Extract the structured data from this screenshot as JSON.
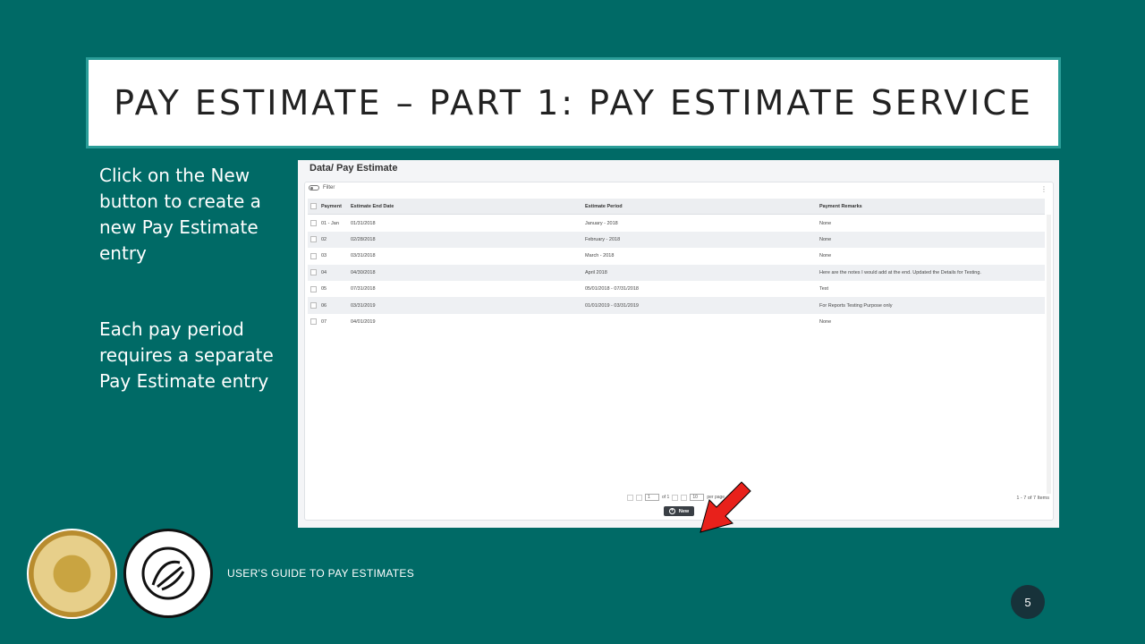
{
  "slide": {
    "title": "PAY ESTIMATE – PART 1: PAY ESTIMATE SERVICE",
    "bullet1": "Click on the New button to create a new Pay Estimate entry",
    "bullet2": "Each pay period requires a separate Pay Estimate entry",
    "footer": "USER'S GUIDE TO PAY ESTIMATES",
    "page_number": "5"
  },
  "app": {
    "breadcrumb": "Data/ Pay Estimate",
    "filter_label": "Filter",
    "columns": [
      "Payment",
      "Estimate End Date",
      "Estimate Period",
      "Payment Remarks"
    ],
    "rows": [
      {
        "payment": "01 - Jan",
        "end_date": "01/31/2018",
        "period": "January - 2018",
        "remarks": "None"
      },
      {
        "payment": "02",
        "end_date": "02/28/2018",
        "period": "February - 2018",
        "remarks": "None"
      },
      {
        "payment": "03",
        "end_date": "03/31/2018",
        "period": "March - 2018",
        "remarks": "None"
      },
      {
        "payment": "04",
        "end_date": "04/30/2018",
        "period": "April 2018",
        "remarks": "Here are the notes I would add at the end. Updated the Details for Testing."
      },
      {
        "payment": "05",
        "end_date": "07/31/2018",
        "period": "05/01/2018 - 07/31/2018",
        "remarks": "Test"
      },
      {
        "payment": "06",
        "end_date": "03/31/2019",
        "period": "01/01/2019 - 03/31/2019",
        "remarks": "For Reports Testing Purpose only"
      },
      {
        "payment": "07",
        "end_date": "04/01/2019",
        "period": "",
        "remarks": "None"
      }
    ],
    "pager": {
      "page": "1",
      "of": "of 1",
      "per_page": "10",
      "per_page_label": "per page"
    },
    "item_count": "1 - 7 of 7 Items",
    "new_button": "New"
  },
  "colors": {
    "background": "#006a66",
    "title_border": "#2a9d98",
    "arrow": "#e8211b"
  }
}
